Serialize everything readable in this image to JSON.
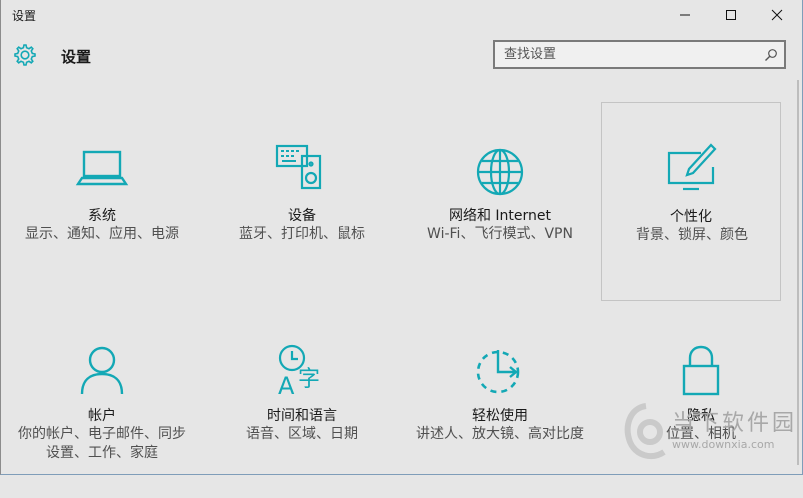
{
  "window": {
    "title": "设置"
  },
  "header": {
    "title": "设置"
  },
  "search": {
    "placeholder": "查找设置"
  },
  "accent_color": "#13a8b5",
  "tiles": [
    {
      "label": "系统",
      "desc": "显示、通知、应用、电源",
      "icon": "laptop-icon"
    },
    {
      "label": "设备",
      "desc": "蓝牙、打印机、鼠标",
      "icon": "devices-icon"
    },
    {
      "label": "网络和 Internet",
      "desc": "Wi-Fi、飞行模式、VPN",
      "icon": "globe-icon"
    },
    {
      "label": "个性化",
      "desc": "背景、锁屏、颜色",
      "icon": "personalization-icon"
    },
    {
      "label": "帐户",
      "desc": "你的帐户、电子邮件、同步设置、工作、家庭",
      "icon": "person-icon"
    },
    {
      "label": "时间和语言",
      "desc": "语音、区域、日期",
      "icon": "time-language-icon"
    },
    {
      "label": "轻松使用",
      "desc": "讲述人、放大镜、高对比度",
      "icon": "ease-of-access-icon"
    },
    {
      "label": "隐私",
      "desc": "位置、相机",
      "icon": "lock-icon"
    }
  ],
  "watermark": {
    "text": "当下软件园",
    "url": "www.downxia.com"
  }
}
